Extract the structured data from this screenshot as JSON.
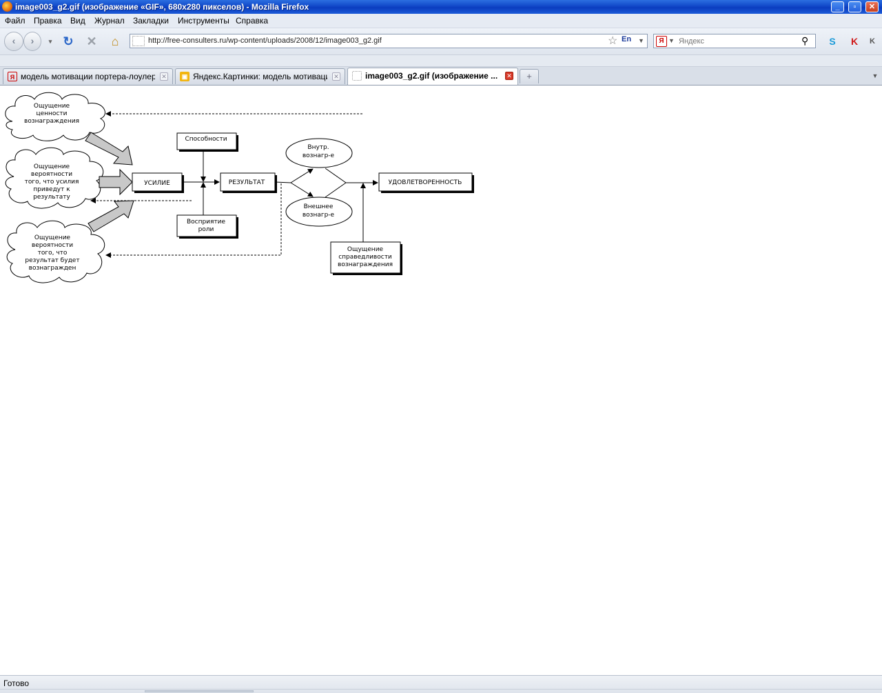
{
  "window": {
    "title": "image003_g2.gif (изображение «GIF», 680x280 пикселов) - Mozilla Firefox"
  },
  "menu": [
    "Файл",
    "Правка",
    "Вид",
    "Журнал",
    "Закладки",
    "Инструменты",
    "Справка"
  ],
  "navbar": {
    "url": "http://free-consulters.ru/wp-content/uploads/2008/12/image003_g2.gif",
    "lang": "En",
    "search_placeholder": "Яндекс"
  },
  "tabs": [
    {
      "label": "модель мотивации портера-лоулера ...",
      "active": false
    },
    {
      "label": "Яндекс.Картинки: модель мотиваци...",
      "active": false
    },
    {
      "label": "image003_g2.gif (изображение ...",
      "active": true
    }
  ],
  "diagram": {
    "cloud_value": [
      "Ощущение",
      "ценности",
      "вознаграждения"
    ],
    "cloud_probability_effort": [
      "Ощущение",
      "вероятности",
      "того, что усилия",
      "приведут к",
      "результату"
    ],
    "cloud_probability_reward": [
      "Ощущение",
      "вероятности",
      "того, что",
      "результат будет",
      "вознагражден"
    ],
    "box_effort": "УСИЛИЕ",
    "box_abilities": "Способности",
    "box_role": [
      "Восприятие",
      "роли"
    ],
    "box_result": "РЕЗУЛЬТАТ",
    "ellipse_internal": [
      "Внутр.",
      "вознагр-е"
    ],
    "ellipse_external": [
      "Внешнее",
      "вознагр-е"
    ],
    "box_satisfaction": "УДОВЛЕТВОРЕННОСТЬ",
    "box_fairness": [
      "Ощущение",
      "справедливости",
      "вознаграждения"
    ]
  },
  "status": {
    "text": "Готово"
  }
}
